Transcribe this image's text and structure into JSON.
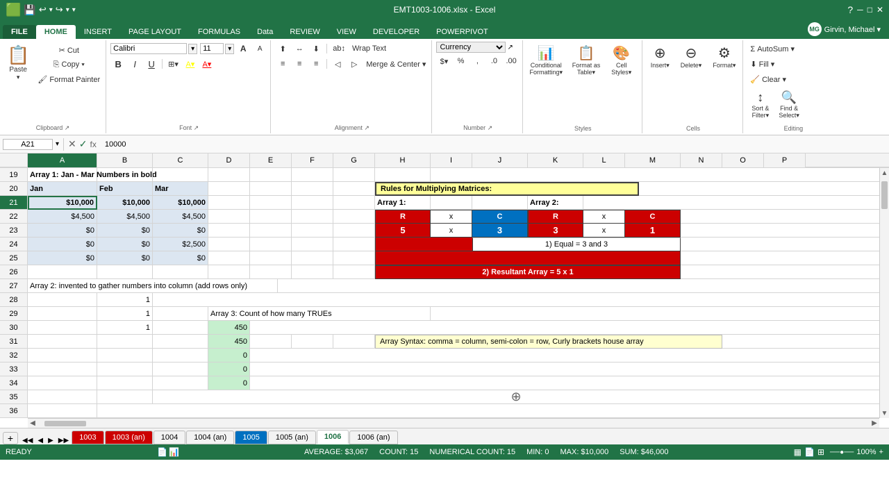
{
  "titlebar": {
    "filename": "EMT1003-1006.xlsx - Excel",
    "quickaccess": [
      "save",
      "undo",
      "redo",
      "customize"
    ]
  },
  "ribbon": {
    "tabs": [
      "FILE",
      "HOME",
      "INSERT",
      "PAGE LAYOUT",
      "FORMULAS",
      "Data",
      "REVIEW",
      "VIEW",
      "DEVELOPER",
      "POWERPIVOT"
    ],
    "active_tab": "HOME",
    "user": "Girvin, Michael",
    "clipboard": {
      "paste_label": "Paste",
      "cut_label": "Cut",
      "copy_label": "Copy",
      "format_painter_label": "Format Painter",
      "group_label": "Clipboard"
    },
    "font": {
      "name": "Calibri",
      "size": "11",
      "grow_label": "A",
      "shrink_label": "A",
      "bold_label": "B",
      "italic_label": "I",
      "underline_label": "U",
      "border_label": "⊞",
      "fill_label": "A",
      "color_label": "A",
      "group_label": "Font"
    },
    "alignment": {
      "top_label": "≡",
      "mid_label": "≡",
      "bot_label": "≡",
      "left_label": "≡",
      "center_label": "≡",
      "right_label": "≡",
      "indent_dec": "◁",
      "indent_inc": "▷",
      "orientation_label": "Orientation",
      "wrap_text_label": "Wrap Text",
      "merge_label": "Merge & Center",
      "group_label": "Alignment"
    },
    "number": {
      "format": "Currency",
      "accounting_label": "$",
      "percent_label": "%",
      "comma_label": ",",
      "dec_inc_label": ".0",
      "dec_dec_label": ".00",
      "group_label": "Number"
    },
    "styles": {
      "cond_format_label": "Conditional Formatting",
      "format_table_label": "Format as Table",
      "cell_styles_label": "Cell Styles",
      "group_label": "Styles"
    },
    "cells": {
      "insert_label": "Insert",
      "delete_label": "Delete",
      "format_label": "Format",
      "group_label": "Cells"
    },
    "editing": {
      "autosum_label": "AutoSum",
      "fill_label": "Fill",
      "clear_label": "Clear",
      "sort_label": "Sort & Filter",
      "find_label": "Find & Select",
      "group_label": "Editing"
    }
  },
  "formula_bar": {
    "cell_ref": "A21",
    "formula": "10000"
  },
  "columns": [
    "",
    "A",
    "B",
    "C",
    "D",
    "E",
    "F",
    "G",
    "H",
    "I",
    "J",
    "K",
    "L",
    "M",
    "N",
    "O",
    "P"
  ],
  "rows": [
    19,
    20,
    21,
    22,
    23,
    24,
    25,
    26,
    27,
    28,
    29,
    30,
    31,
    32,
    33,
    34,
    35,
    36
  ],
  "cells": {
    "A19": {
      "value": "Array 1: Jan - Mar Numbers in bold",
      "bold": true
    },
    "A20": {
      "value": "Jan",
      "bold": true,
      "bg": "blue-data"
    },
    "B20": {
      "value": "Feb",
      "bold": true,
      "bg": "blue-data"
    },
    "C20": {
      "value": "Mar",
      "bold": true,
      "bg": "blue-data"
    },
    "A21": {
      "value": "$10,000",
      "bold": true,
      "bg": "blue-data",
      "selected": true
    },
    "B21": {
      "value": "$10,000",
      "bold": true,
      "bg": "blue-data"
    },
    "C21": {
      "value": "$10,000",
      "bold": true,
      "bg": "blue-data"
    },
    "A22": {
      "value": "$4,500",
      "bg": "blue-data"
    },
    "B22": {
      "value": "$4,500",
      "bg": "blue-data"
    },
    "C22": {
      "value": "$4,500",
      "bg": "blue-data"
    },
    "A23": {
      "value": "$0",
      "bg": "blue-data"
    },
    "B23": {
      "value": "$0",
      "bg": "blue-data"
    },
    "C23": {
      "value": "$0",
      "bg": "blue-data"
    },
    "A24": {
      "value": "$0",
      "bg": "blue-data"
    },
    "B24": {
      "value": "$0",
      "bg": "blue-data"
    },
    "C24": {
      "value": "$2,500",
      "bg": "blue-data"
    },
    "A25": {
      "value": "$0",
      "bg": "blue-data"
    },
    "B25": {
      "value": "$0",
      "bg": "blue-data"
    },
    "C25": {
      "value": "$0",
      "bg": "blue-data"
    },
    "A27": {
      "value": "Array 2: invented to gather numbers into column (add rows only)"
    },
    "B28": {
      "value": "1",
      "align": "right"
    },
    "B29": {
      "value": "1",
      "align": "right"
    },
    "A29": {
      "value": "Array 3: Count of how many TRUEs"
    },
    "B30": {
      "value": "1",
      "align": "right"
    },
    "D30": {
      "value": "450",
      "align": "right",
      "bg": "green"
    },
    "D31": {
      "value": "450",
      "align": "right",
      "bg": "green"
    },
    "D32": {
      "value": "0",
      "align": "right",
      "bg": "green"
    },
    "D33": {
      "value": "0",
      "align": "right",
      "bg": "green"
    },
    "D34": {
      "value": "0",
      "align": "right",
      "bg": "green"
    },
    "H31_wide": {
      "value": "Array Syntax: comma = column, semi-colon = row, Curly brackets house array",
      "bg": "yellow-note"
    },
    "H20": {
      "value": "Rules for Multiplying Matrices:",
      "bold": true,
      "bg": "yellow-header"
    },
    "H21": {
      "value": "Array 1:",
      "bold": true
    },
    "K21": {
      "value": "Array 2:",
      "bold": true
    },
    "H22_R": {
      "value": "R",
      "bg": "red",
      "color": "white"
    },
    "I22": {
      "value": "x"
    },
    "J22_C": {
      "value": "C",
      "bg": "blue-dark",
      "color": "white"
    },
    "K22_R": {
      "value": "R",
      "bg": "red",
      "color": "white"
    },
    "L22": {
      "value": "x"
    },
    "M22_C": {
      "value": "C",
      "bg": "red",
      "color": "white"
    },
    "H23": {
      "value": "5",
      "bg": "red",
      "color": "white",
      "bold": true
    },
    "I23": {
      "value": "x"
    },
    "J23": {
      "value": "3",
      "bg": "blue-dark",
      "color": "white",
      "bold": true
    },
    "K23": {
      "value": "3",
      "bg": "red",
      "color": "white",
      "bold": true
    },
    "L23": {
      "value": "x"
    },
    "M23": {
      "value": "1",
      "bg": "red",
      "color": "white",
      "bold": true
    },
    "HJ24_merged": {
      "value": "",
      "bg": "red"
    },
    "JK24_merged": {
      "value": "1) Equal = 3 and 3",
      "bg": "white",
      "border": true
    },
    "H26_wide": {
      "value": "2) Resultant Array = 5 x 1",
      "bg": "red",
      "color": "white",
      "bold": true
    }
  },
  "sheet_tabs": [
    {
      "label": "1003",
      "type": "red"
    },
    {
      "label": "1003 (an)",
      "type": "red"
    },
    {
      "label": "1004",
      "type": "normal"
    },
    {
      "label": "1004 (an)",
      "type": "normal"
    },
    {
      "label": "1005",
      "type": "blue"
    },
    {
      "label": "1005 (an)",
      "type": "normal"
    },
    {
      "label": "1006",
      "type": "active"
    },
    {
      "label": "1006 (an)",
      "type": "normal"
    }
  ],
  "status_bar": {
    "mode": "READY",
    "average": "AVERAGE: $3,067",
    "count": "COUNT: 15",
    "numerical_count": "NUMERICAL COUNT: 15",
    "min": "MIN: 0",
    "max": "MAX: $10,000",
    "sum": "SUM: $46,000"
  }
}
